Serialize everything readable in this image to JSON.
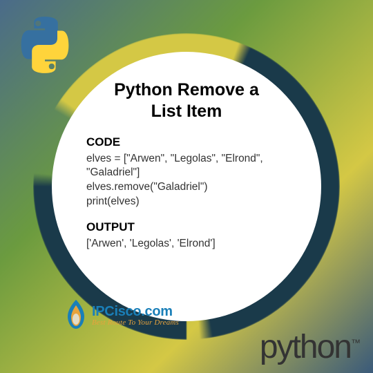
{
  "title_line1": "Python Remove a",
  "title_line2": "List Item",
  "code_label": "CODE",
  "code_content": "elves = [\"Arwen\", \"Legolas\", \"Elrond\",\n\"Galadriel\"]\nelves.remove(\"Galadriel\")\nprint(elves)",
  "output_label": "OUTPUT",
  "output_content": "['Arwen', 'Legolas', 'Elrond']",
  "ipcisco_name": "IPCisco.com",
  "ipcisco_tagline": "Best Route To Your Dreams",
  "python_brand": "python",
  "trademark": "™"
}
